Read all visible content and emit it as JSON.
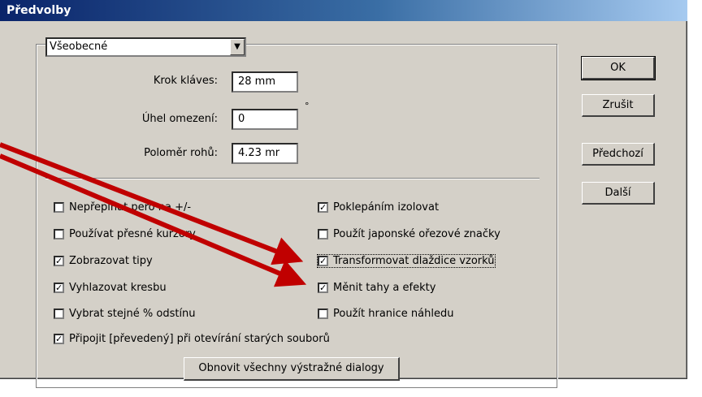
{
  "window": {
    "title": "Předvolby"
  },
  "category": {
    "selected": "Všeobecné"
  },
  "fields": [
    {
      "label": "Krok kláves:",
      "value": "28 mm"
    },
    {
      "label": "Úhel omezení:",
      "value": "0"
    },
    {
      "label": "Poloměr rohů:",
      "value": "4.23 mr"
    }
  ],
  "degree_symbol": "°",
  "checkboxes_left": [
    {
      "label": "Nepřepínat pero na +/-",
      "checked": false
    },
    {
      "label": "Používat přesné kurzory",
      "checked": false
    },
    {
      "label": "Zobrazovat tipy",
      "checked": true
    },
    {
      "label": "Vyhlazovat kresbu",
      "checked": true
    },
    {
      "label": "Vybrat stejné % odstínu",
      "checked": false
    }
  ],
  "checkboxes_right": [
    {
      "label": "Poklepáním izolovat",
      "checked": true
    },
    {
      "label": "Použít japonské ořezové značky",
      "checked": false
    },
    {
      "label": "Transformovat dlaždice vzorků",
      "checked": true
    },
    {
      "label": "Měnit tahy a efekty",
      "checked": true
    },
    {
      "label": "Použít hranice náhledu",
      "checked": false
    }
  ],
  "checkbox_bottom": {
    "label": "Připojit [převedený] při otevírání starých souborů",
    "checked": true
  },
  "reset_button": "Obnovit všechny výstražné dialogy",
  "buttons": {
    "ok": "OK",
    "cancel": "Zrušit",
    "previous": "Předchozí",
    "next": "Další"
  },
  "colors": {
    "arrow": "#c00000",
    "dialog_bg": "#d4d0c8",
    "title_start": "#0a246a",
    "title_end": "#a6caf0"
  }
}
